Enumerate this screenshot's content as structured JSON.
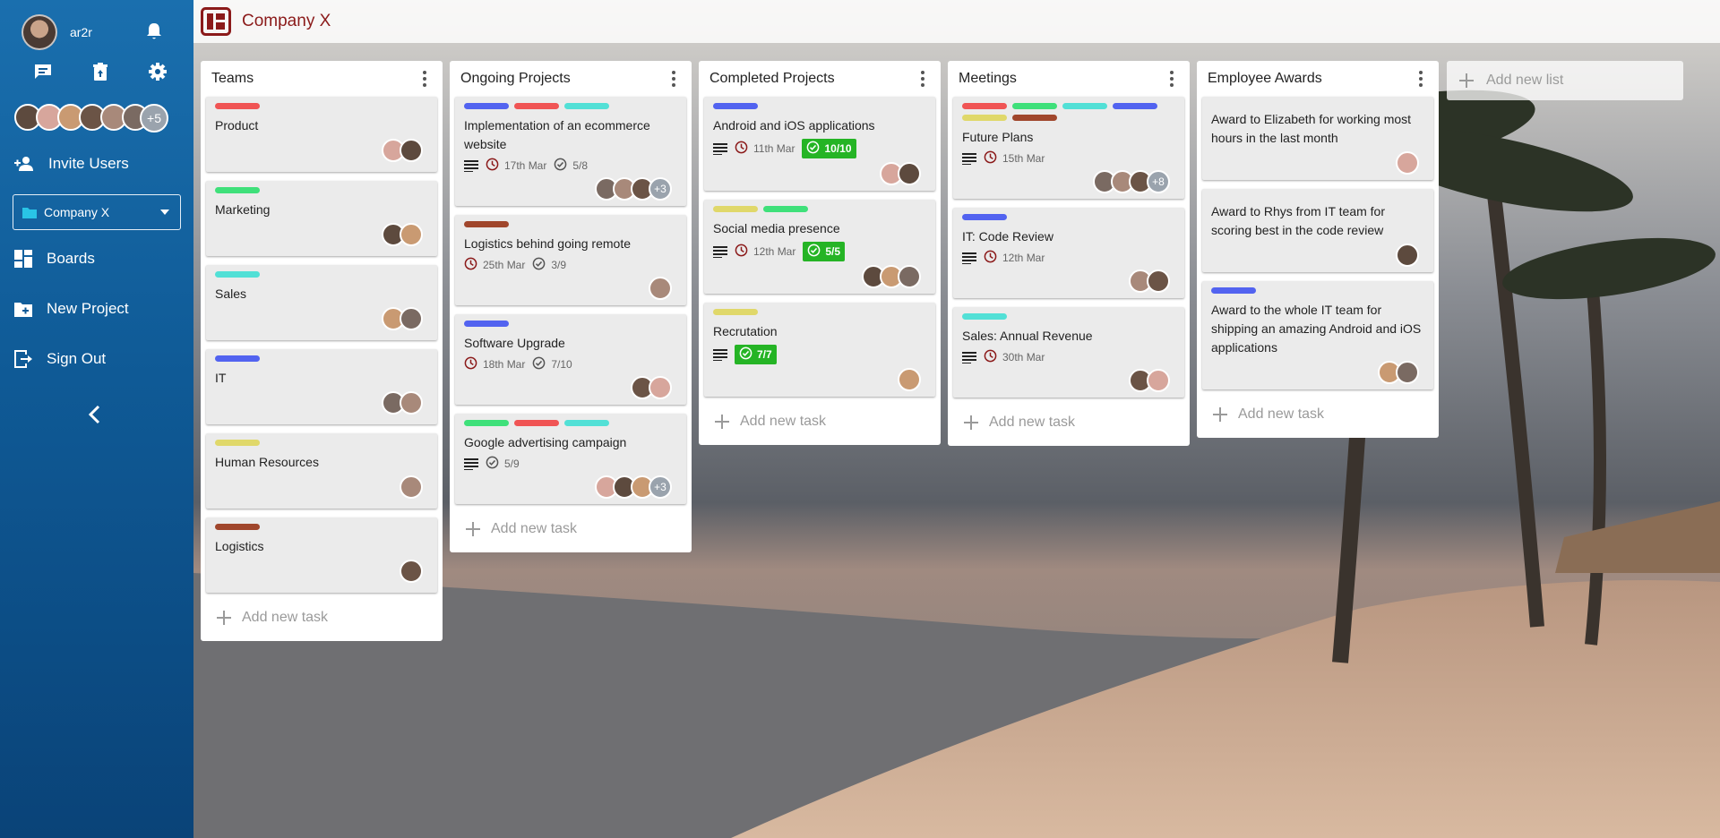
{
  "sidebar": {
    "username": "ar2r",
    "more_members": "+5",
    "invite_label": "Invite Users",
    "company_select": "Company X",
    "nav": {
      "boards": "Boards",
      "new_project": "New Project",
      "sign_out": "Sign Out"
    }
  },
  "topbar": {
    "board_title": "Company X"
  },
  "colors": {
    "red": "#f05454",
    "green": "#3fe07a",
    "teal": "#52e0d6",
    "blue": "#5263f0",
    "yellow": "#e0d86a",
    "brown": "#a0462c",
    "accent": "#8b1a1a",
    "check": "#25b425"
  },
  "lists": [
    {
      "title": "Teams",
      "add_label": "Add new task",
      "cards": [
        {
          "title": "Product",
          "labels": [
            "red"
          ],
          "avatars": 2
        },
        {
          "title": "Marketing",
          "labels": [
            "green"
          ],
          "avatars": 2
        },
        {
          "title": "Sales",
          "labels": [
            "teal"
          ],
          "avatars": 2
        },
        {
          "title": "IT",
          "labels": [
            "blue"
          ],
          "avatars": 2
        },
        {
          "title": "Human Resources",
          "labels": [
            "yellow"
          ],
          "avatars": 1
        },
        {
          "title": "Logistics",
          "labels": [
            "brown"
          ],
          "avatars": 1
        }
      ]
    },
    {
      "title": "Ongoing Projects",
      "add_label": "Add new task",
      "cards": [
        {
          "title": "Implementation of an ecommerce website",
          "labels": [
            "blue",
            "red",
            "teal"
          ],
          "desc": true,
          "date": "17th Mar",
          "checklist": "5/8",
          "avatars": 3,
          "more": "+3"
        },
        {
          "title": "Logistics behind going remote",
          "labels": [
            "brown"
          ],
          "date": "25th Mar",
          "checklist": "3/9",
          "avatars": 1
        },
        {
          "title": "Software Upgrade",
          "labels": [
            "blue"
          ],
          "date": "18th Mar",
          "checklist": "7/10",
          "avatars": 2
        },
        {
          "title": "Google advertising campaign",
          "labels": [
            "green",
            "red",
            "teal"
          ],
          "desc": true,
          "checklist": "5/9",
          "avatars": 3,
          "more": "+3"
        }
      ]
    },
    {
      "title": "Completed Projects",
      "add_label": "Add new task",
      "cards": [
        {
          "title": "Android and iOS applications",
          "labels": [
            "blue"
          ],
          "desc": true,
          "date": "11th Mar",
          "done": "10/10",
          "avatars": 2
        },
        {
          "title": "Social media presence",
          "labels": [
            "yellow",
            "green"
          ],
          "desc": true,
          "date": "12th Mar",
          "done": "5/5",
          "avatars": 3
        },
        {
          "title": "Recrutation",
          "labels": [
            "yellow"
          ],
          "desc": true,
          "done": "7/7",
          "avatars": 1
        }
      ]
    },
    {
      "title": "Meetings",
      "add_label": "Add new task",
      "cards": [
        {
          "title": "Future Plans",
          "labels": [
            "red",
            "green",
            "teal",
            "blue",
            "yellow",
            "brown"
          ],
          "desc": true,
          "date": "15th Mar",
          "avatars": 3,
          "more": "+8"
        },
        {
          "title": "IT: Code Review",
          "labels": [
            "blue"
          ],
          "desc": true,
          "date": "12th Mar",
          "avatars": 2
        },
        {
          "title": "Sales: Annual Revenue",
          "labels": [
            "teal"
          ],
          "desc": true,
          "date": "30th Mar",
          "avatars": 2
        }
      ]
    },
    {
      "title": "Employee Awards",
      "add_label": "Add new task",
      "cards": [
        {
          "title": "Award to Elizabeth for working most hours in the last month",
          "labels": [],
          "avatars": 1
        },
        {
          "title": "Award to Rhys from IT team for scoring best in the code review",
          "labels": [],
          "avatars": 1
        },
        {
          "title": "Award to the whole IT team for shipping an amazing Android and iOS applications",
          "labels": [
            "blue"
          ],
          "avatars": 2
        }
      ]
    }
  ],
  "add_list_label": "Add new list"
}
